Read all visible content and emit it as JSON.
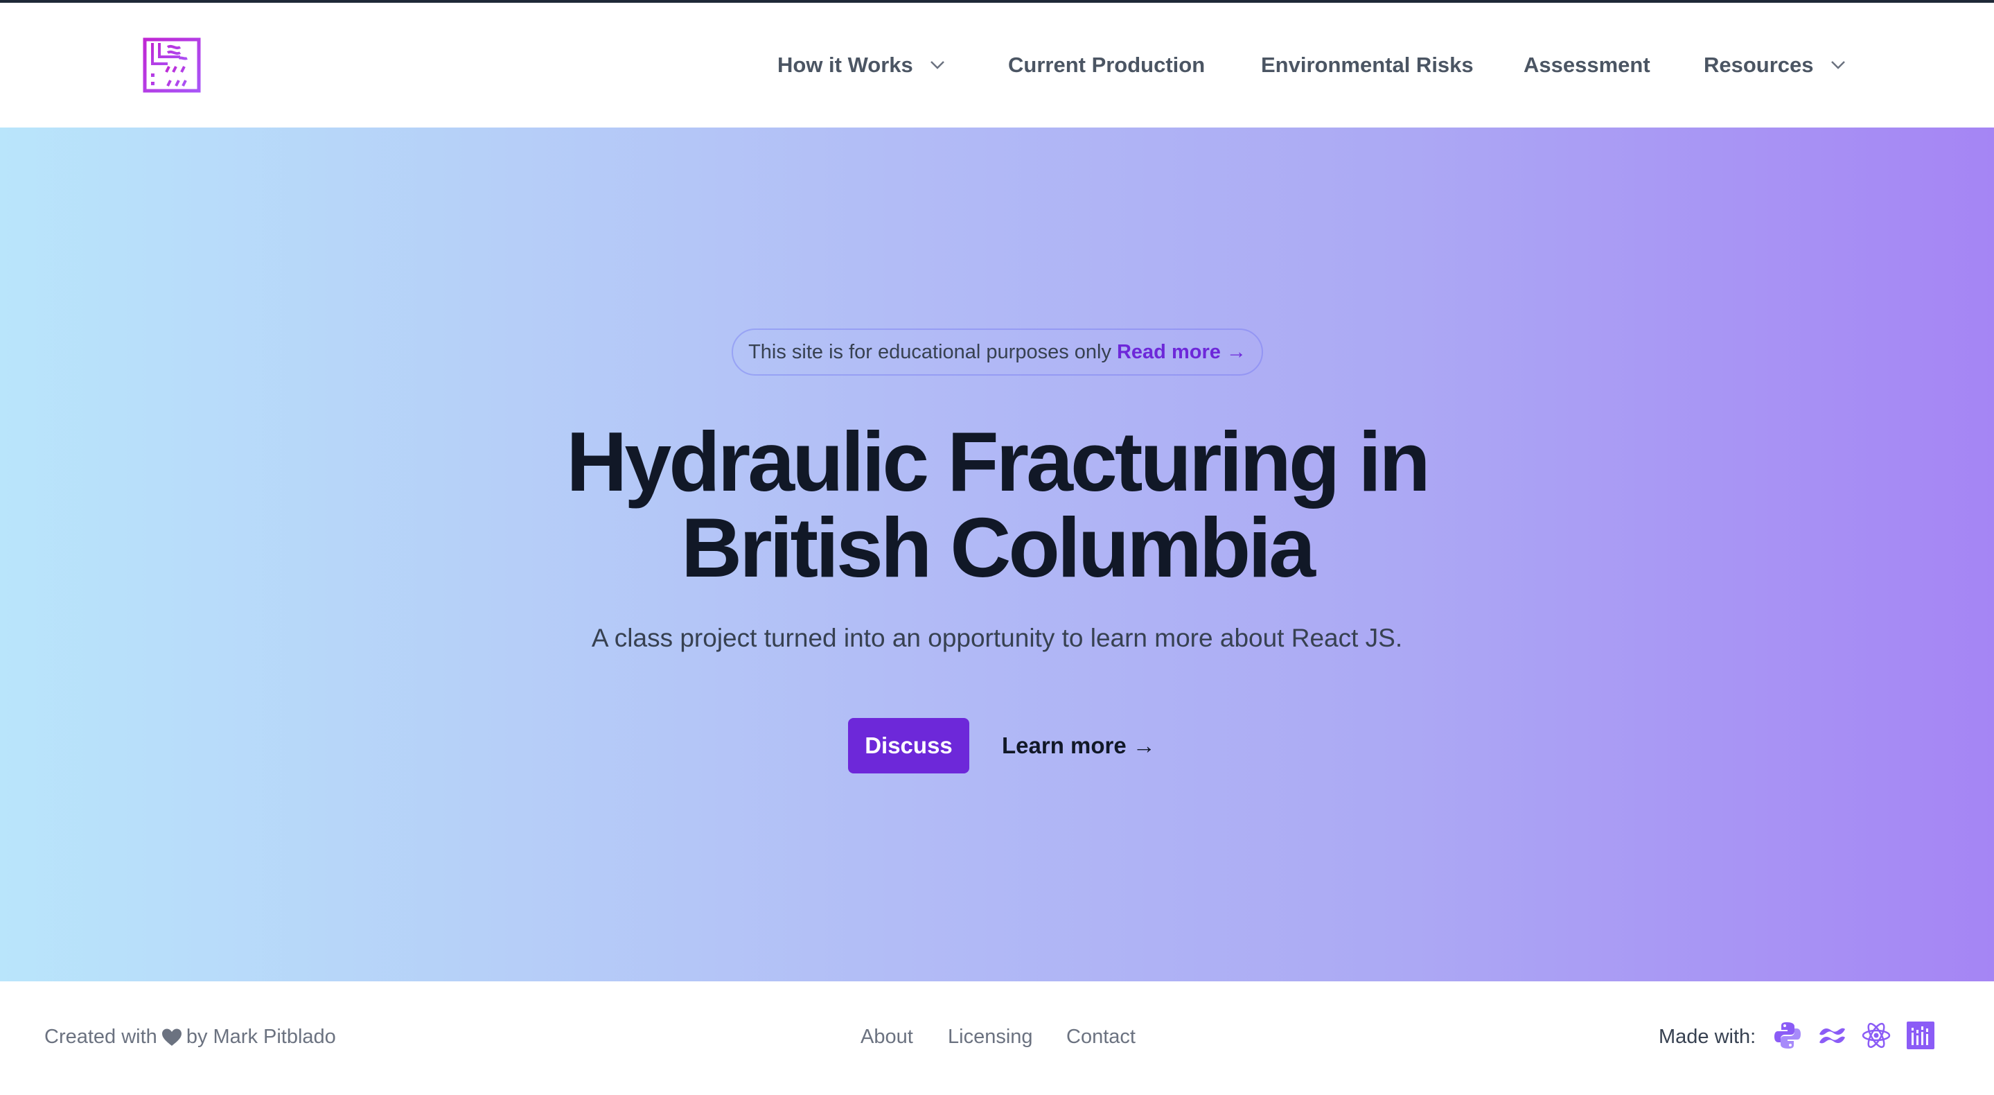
{
  "header": {
    "nav": [
      {
        "label": "How it Works",
        "has_dropdown": true
      },
      {
        "label": "Current Production",
        "has_dropdown": false
      },
      {
        "label": "Environmental Risks",
        "has_dropdown": false
      },
      {
        "label": "Assessment",
        "has_dropdown": false
      },
      {
        "label": "Resources",
        "has_dropdown": true
      }
    ]
  },
  "hero": {
    "notice_text": "This site is for educational purposes only",
    "notice_link": "Read more →",
    "title_line1": "Hydraulic Fracturing in",
    "title_line2": "British Columbia",
    "subtitle": "A class project turned into an opportunity to learn more about React JS.",
    "primary_button": "Discuss",
    "secondary_button": "Learn more →"
  },
  "footer": {
    "credit_prefix": "Created with",
    "credit_suffix": "by Mark Pitblado",
    "links": [
      "About",
      "Licensing",
      "Contact"
    ],
    "made_with_label": "Made with:",
    "tech_icons": [
      "python-icon",
      "tailwind-icon",
      "react-icon",
      "chart-library-icon"
    ]
  },
  "colors": {
    "accent": "#6d28d9",
    "tech_icon": "#8b5cf6",
    "text_dark": "#111827",
    "nav_text": "#4b5563"
  }
}
